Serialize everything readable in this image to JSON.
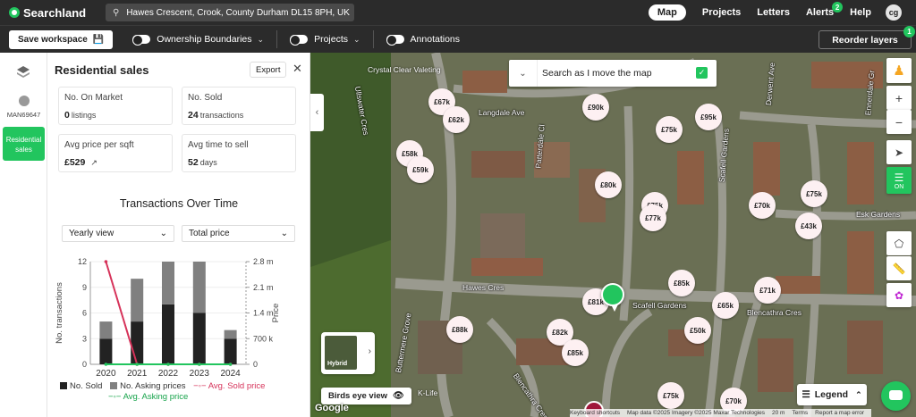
{
  "app": {
    "name": "Searchland"
  },
  "search": {
    "value": "Hawes Crescent, Crook, County Durham DL15 8PH, UK"
  },
  "nav": {
    "items": [
      "Map",
      "Projects",
      "Letters",
      "Alerts",
      "Help"
    ],
    "alerts_count": "2",
    "avatar": "cg"
  },
  "toolbar": {
    "save_label": "Save workspace",
    "ownership": "Ownership Boundaries",
    "projects": "Projects",
    "annotations": "Annotations",
    "reorder": "Reorder layers",
    "reorder_count": "1"
  },
  "rail": {
    "user": "MAN69647",
    "active_line1": "Residential",
    "active_line2": "sales"
  },
  "panel": {
    "title": "Residential sales",
    "export": "Export",
    "stats": [
      {
        "label": "No. On Market",
        "value": "0",
        "unit": "listings"
      },
      {
        "label": "No. Sold",
        "value": "24",
        "unit": "transactions"
      },
      {
        "label": "Avg price per sqft",
        "value": "£529",
        "unit": ""
      },
      {
        "label": "Avg time to sell",
        "value": "52",
        "unit": "days"
      }
    ],
    "chart_title": "Transactions Over Time",
    "view_select": "Yearly view",
    "metric_select": "Total price"
  },
  "chart_data": {
    "type": "bar",
    "categories": [
      "2020",
      "2021",
      "2022",
      "2023",
      "2024"
    ],
    "series": [
      {
        "name": "No. Sold",
        "values": [
          3,
          5,
          7,
          6,
          3
        ],
        "color": "#222222"
      },
      {
        "name": "No. Asking prices",
        "values": [
          2,
          5,
          5,
          6,
          1
        ],
        "color": "#808080"
      },
      {
        "name": "Avg. Sold price",
        "values": [
          2800000,
          0,
          0,
          0,
          0
        ],
        "color": "#d6335a"
      },
      {
        "name": "Avg. Asking price",
        "values": [
          0,
          0,
          0,
          0,
          0
        ],
        "color": "#22c55e"
      }
    ],
    "ylabel": "No. transactions",
    "ylabel_right": "Price",
    "ylim": [
      0,
      12
    ],
    "yticks": [
      "0",
      "3",
      "6",
      "9",
      "12"
    ],
    "ylim_right": [
      0,
      2800000
    ],
    "yticks_right": [
      "0",
      "700 k",
      "1.4 m",
      "2.1 m",
      "2.8 m"
    ],
    "stacked": true
  },
  "map": {
    "search_move": "Search as I move the map",
    "prices": [
      "£67k",
      "£62k",
      "£90k",
      "£95k",
      "£75k",
      "£58k",
      "£59k",
      "£80k",
      "£75k",
      "£77k",
      "£70k",
      "£75k",
      "£43k",
      "£85k",
      "£71k",
      "£81k",
      "£65k",
      "£88k",
      "£82k",
      "£85k",
      "£50k",
      "£75k",
      "£70k"
    ],
    "streets": [
      "Crystal Clear Valeting",
      "Langdale Ave",
      "Ullswater Cres",
      "Patterdale Cl",
      "Scafell Gardens",
      "Derwent Ave",
      "Ennerdale Gr",
      "Esk Gardens",
      "Hawes Cres",
      "Scafell Gardens",
      "Blencathra Cres",
      "Buttermere Grove",
      "Blencathra Cres",
      "K-Life"
    ],
    "hybrid": "Hybrid",
    "birds_eye": "Birds eye view",
    "google": "Google",
    "legend": "Legend",
    "ctrl_on": "ON",
    "attribution": [
      "Keyboard shortcuts",
      "Map data ©2025 Imagery ©2025 Maxar Technologies",
      "20 m",
      "Terms",
      "Report a map error"
    ]
  }
}
